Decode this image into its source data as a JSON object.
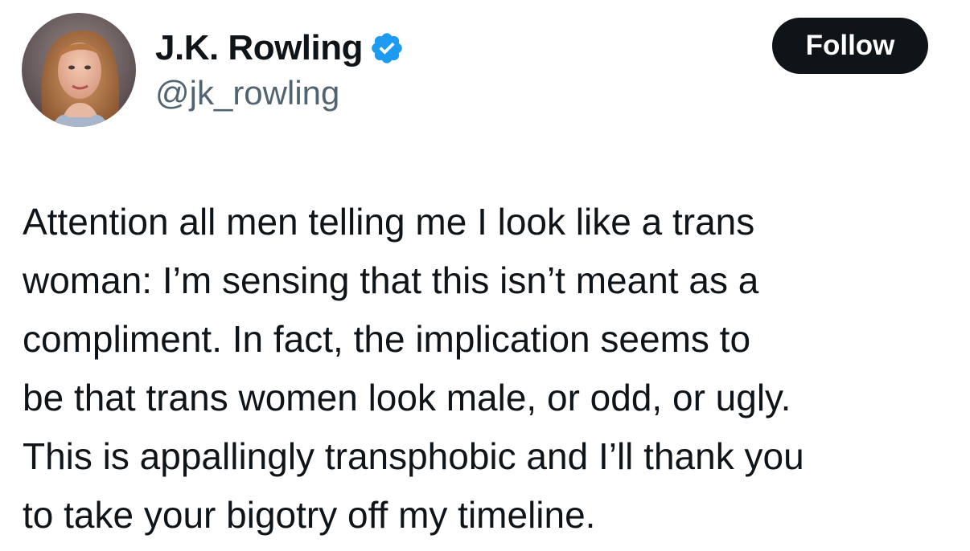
{
  "author": {
    "display_name": "J.K. Rowling",
    "handle": "@jk_rowling",
    "verified": true,
    "verified_color": "#1d9bf0"
  },
  "follow_button": {
    "label": "Follow",
    "background": "#0f1419",
    "text_color": "#ffffff"
  },
  "tweet": {
    "lines": [
      "Attention all men telling me I look like a trans",
      "woman: I’m sensing that this isn’t meant as a",
      "compliment. In fact, the implication seems to",
      "be that trans women look male, or odd, or ugly.",
      "This is appallingly transphobic and I’ll thank you",
      "to take your bigotry off my timeline."
    ]
  },
  "icons": {
    "avatar": "profile-photo",
    "verified": "verified-badge-icon"
  }
}
